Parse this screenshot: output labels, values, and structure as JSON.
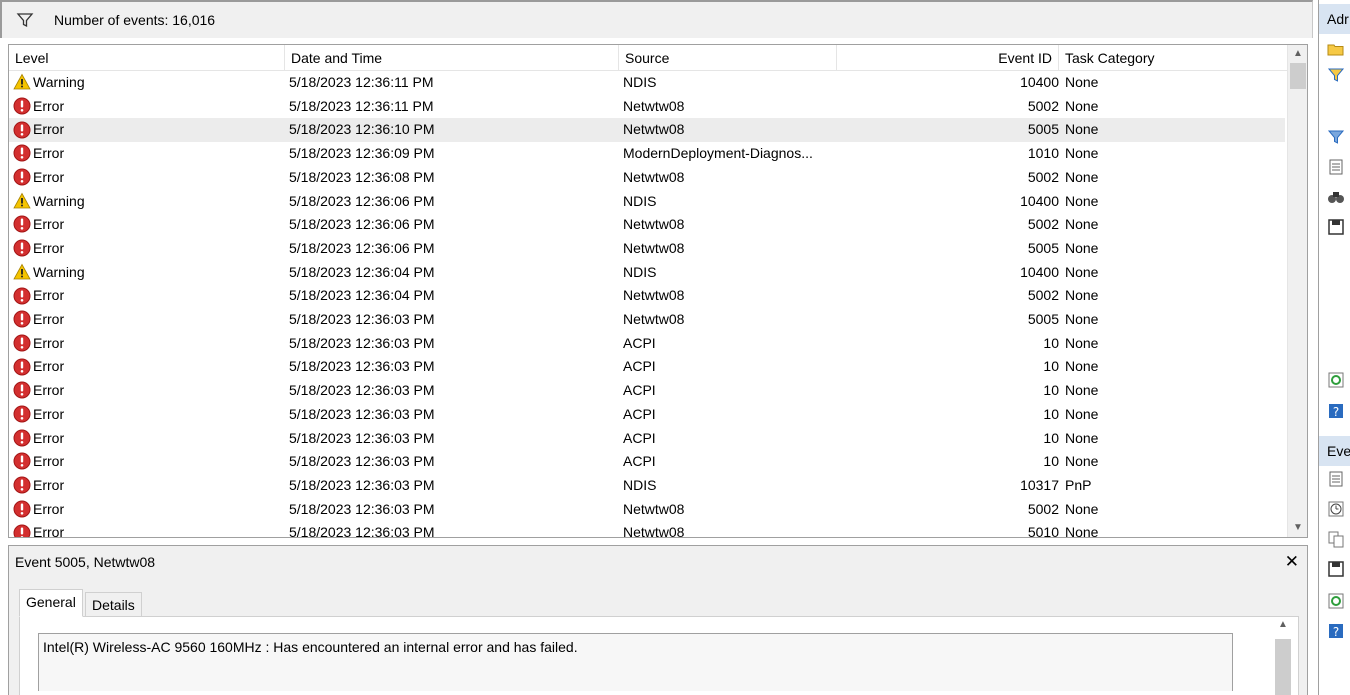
{
  "topbar": {
    "event_count_label": "Number of events: 16,016"
  },
  "columns": [
    "Level",
    "Date and Time",
    "Source",
    "Event ID",
    "Task Category"
  ],
  "events": [
    {
      "level": "Warning",
      "date": "5/18/2023 12:36:11 PM",
      "source": "NDIS",
      "event_id": "10400",
      "task": "None",
      "selected": false
    },
    {
      "level": "Error",
      "date": "5/18/2023 12:36:11 PM",
      "source": "Netwtw08",
      "event_id": "5002",
      "task": "None",
      "selected": false
    },
    {
      "level": "Error",
      "date": "5/18/2023 12:36:10 PM",
      "source": "Netwtw08",
      "event_id": "5005",
      "task": "None",
      "selected": true
    },
    {
      "level": "Error",
      "date": "5/18/2023 12:36:09 PM",
      "source": "ModernDeployment-Diagnos...",
      "event_id": "1010",
      "task": "None",
      "selected": false
    },
    {
      "level": "Error",
      "date": "5/18/2023 12:36:08 PM",
      "source": "Netwtw08",
      "event_id": "5002",
      "task": "None",
      "selected": false
    },
    {
      "level": "Warning",
      "date": "5/18/2023 12:36:06 PM",
      "source": "NDIS",
      "event_id": "10400",
      "task": "None",
      "selected": false
    },
    {
      "level": "Error",
      "date": "5/18/2023 12:36:06 PM",
      "source": "Netwtw08",
      "event_id": "5002",
      "task": "None",
      "selected": false
    },
    {
      "level": "Error",
      "date": "5/18/2023 12:36:06 PM",
      "source": "Netwtw08",
      "event_id": "5005",
      "task": "None",
      "selected": false
    },
    {
      "level": "Warning",
      "date": "5/18/2023 12:36:04 PM",
      "source": "NDIS",
      "event_id": "10400",
      "task": "None",
      "selected": false
    },
    {
      "level": "Error",
      "date": "5/18/2023 12:36:04 PM",
      "source": "Netwtw08",
      "event_id": "5002",
      "task": "None",
      "selected": false
    },
    {
      "level": "Error",
      "date": "5/18/2023 12:36:03 PM",
      "source": "Netwtw08",
      "event_id": "5005",
      "task": "None",
      "selected": false
    },
    {
      "level": "Error",
      "date": "5/18/2023 12:36:03 PM",
      "source": "ACPI",
      "event_id": "10",
      "task": "None",
      "selected": false
    },
    {
      "level": "Error",
      "date": "5/18/2023 12:36:03 PM",
      "source": "ACPI",
      "event_id": "10",
      "task": "None",
      "selected": false
    },
    {
      "level": "Error",
      "date": "5/18/2023 12:36:03 PM",
      "source": "ACPI",
      "event_id": "10",
      "task": "None",
      "selected": false
    },
    {
      "level": "Error",
      "date": "5/18/2023 12:36:03 PM",
      "source": "ACPI",
      "event_id": "10",
      "task": "None",
      "selected": false
    },
    {
      "level": "Error",
      "date": "5/18/2023 12:36:03 PM",
      "source": "ACPI",
      "event_id": "10",
      "task": "None",
      "selected": false
    },
    {
      "level": "Error",
      "date": "5/18/2023 12:36:03 PM",
      "source": "ACPI",
      "event_id": "10",
      "task": "None",
      "selected": false
    },
    {
      "level": "Error",
      "date": "5/18/2023 12:36:03 PM",
      "source": "NDIS",
      "event_id": "10317",
      "task": "PnP",
      "selected": false
    },
    {
      "level": "Error",
      "date": "5/18/2023 12:36:03 PM",
      "source": "Netwtw08",
      "event_id": "5002",
      "task": "None",
      "selected": false
    },
    {
      "level": "Error",
      "date": "5/18/2023 12:36:03 PM",
      "source": "Netwtw08",
      "event_id": "5010",
      "task": "None",
      "selected": false
    }
  ],
  "details": {
    "title": "Event 5005, Netwtw08",
    "tabs": [
      "General",
      "Details"
    ],
    "message": "Intel(R) Wireless-AC 9560 160MHz : Has encountered an internal error and has failed."
  },
  "actions": {
    "section1_title": "Adr",
    "section2_title": "Eve",
    "icons1": [
      "open-log-icon",
      "create-view-icon",
      "filter-icon",
      "properties-icon",
      "find-icon",
      "save-icon",
      "refresh-icon",
      "help-icon"
    ],
    "icons2": [
      "event-properties-icon",
      "attach-task-icon",
      "copy-icon",
      "save-event-icon",
      "refresh-icon",
      "help-icon"
    ]
  },
  "colors": {
    "error_red": "#d32f2f",
    "warning_yellow": "#f5c400",
    "selected_row": "#ececec",
    "action_header": "#d8e4f2"
  }
}
